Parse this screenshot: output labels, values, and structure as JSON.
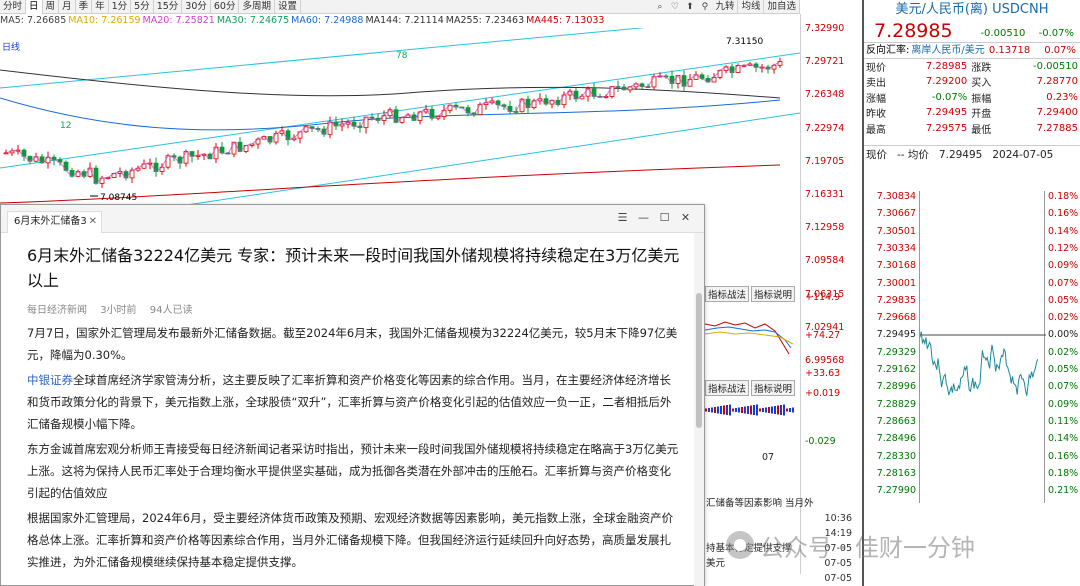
{
  "toolbar": {
    "periods": [
      "分时",
      "日",
      "周",
      "月",
      "季",
      "年",
      "1分",
      "5分",
      "15分",
      "30分",
      "60分",
      "多周期",
      "设置"
    ],
    "active_period": "日",
    "right_buttons": [
      "九转",
      "均线",
      "加自选"
    ]
  },
  "ma": [
    {
      "label": "MA5: 7.26685",
      "color": "#444"
    },
    {
      "label": "MA10: 7.26159",
      "color": "#e0a800"
    },
    {
      "label": "MA20: 7.25821",
      "color": "#d040d0"
    },
    {
      "label": "MA30: 7.24675",
      "color": "#16a05d"
    },
    {
      "label": "MA60: 7.24988",
      "color": "#1a6ad6"
    },
    {
      "label": "MA144: 7.21114",
      "color": "#333"
    },
    {
      "label": "MA255: 7.23463",
      "color": "#333"
    },
    {
      "label": "MA445: 7.13033",
      "color": "#c00"
    }
  ],
  "chart": {
    "day_label": "日线",
    "high_label": "7.31150",
    "low_label": "7.08745",
    "mark_78": "78",
    "mark_12": "12",
    "yaxis": [
      "7.32990",
      "7.29721",
      "7.26348",
      "7.22974",
      "7.19705",
      "7.16331",
      "7.12958",
      "7.09584",
      "7.06315",
      "7.02941",
      "6.99568"
    ]
  },
  "sub": {
    "tabs": [
      "指标战法",
      "指标说明"
    ],
    "yaxis_1": [
      "+114.9",
      "+74.27",
      "+33.63"
    ],
    "yaxis_2": [
      "+0.019",
      "-0.029"
    ],
    "date_label": "07"
  },
  "right": {
    "title": "美元/人民币(离) USDCNH",
    "price": "7.28985",
    "change": "-0.00510",
    "change_pct": "-0.07%",
    "rate_label": "反向汇率:",
    "rate_select": "离岸人民币/美元",
    "rate_value": "0.13718",
    "rate_pct": "0.07%",
    "quotes": [
      {
        "l1": "现价",
        "v1": "7.28985",
        "l2": "涨跌",
        "v2": "-0.00510",
        "g1": false,
        "g2": true
      },
      {
        "l1": "卖出",
        "v1": "7.29200",
        "l2": "买入",
        "v2": "7.28770",
        "g1": false,
        "g2": false
      },
      {
        "l1": "涨幅",
        "v1": "-0.07%",
        "l2": "振幅",
        "v2": "0.23%",
        "g1": true,
        "g2": false
      },
      {
        "l1": "昨收",
        "v1": "7.29495",
        "l2": "开盘",
        "v2": "7.29400",
        "g1": false,
        "g2": false
      },
      {
        "l1": "最高",
        "v1": "7.29575",
        "l2": "最低",
        "v2": "7.27885",
        "g1": false,
        "g2": false
      }
    ],
    "current_row": {
      "label": "现价",
      "dash": "-- 均价",
      "avg": "7.29495",
      "date": "2024-07-05"
    },
    "mini_left": [
      "7.30834",
      "7.30667",
      "7.30501",
      "7.30334",
      "7.30168",
      "7.30001",
      "7.29835",
      "7.29668",
      "7.29495",
      "7.29329",
      "7.29162",
      "7.28996",
      "7.28829",
      "7.28663",
      "7.28496",
      "7.28330",
      "7.28163",
      "7.27990"
    ],
    "mini_right": [
      "0.18%",
      "0.16%",
      "0.14%",
      "0.12%",
      "0.09%",
      "0.07%",
      "0.05%",
      "0.02%",
      "0.00%",
      "0.02%",
      "0.05%",
      "0.07%",
      "0.09%",
      "0.11%",
      "0.14%",
      "0.16%",
      "0.18%",
      "0.21%"
    ]
  },
  "news": {
    "tab_label": "6月末外汇储备3",
    "title": "6月末外汇储备32224亿美元 专家：预计未来一段时间我国外储规模将持续稳定在3万亿美元以上",
    "source": "每日经济新闻",
    "time": "3小时前",
    "reads": "94人已读",
    "p1": "7月7日，国家外汇管理局发布最新外汇储备数据。截至2024年6月末，我国外汇储备规模为32224亿美元，较5月末下降97亿美元，降幅为0.30%。",
    "p2_link": "中银证券",
    "p2": "全球首席经济学家管涛分析，这主要反映了汇率折算和资产价格变化等因素的综合作用。当月，在主要经济体经济增长和货币政策分化的背景下，美元指数上涨，全球股债“双升”，汇率折算与资产价格变化引起的估值效应一负一正，二者相抵后外汇储备规模小幅下降。",
    "p3": "东方金诚首席宏观分析师王青接受每日经济新闻记者采访时指出，预计未来一段时间我国外储规模将持续稳定在略高于3万亿美元上涨。这将为保持人民币汇率处于合理均衡水平提供坚实基础，成为抵御各类潜在外部冲击的压舱石。汇率折算与资产价格变化引起的估值效应",
    "p4": "根据国家外汇管理局，2024年6月，受主要经济体货币政策及预期、宏观经济数据等因素影响，美元指数上涨，全球金融资产价格总体上涨。汇率折算和资产价格等因素综合作用，当月外汇储备规模下降。但我国经济运行延续回升向好态势，高质量发展扎实推进，为外汇储备规模继续保持基本稳定提供支撑。"
  },
  "news_list": [
    {
      "title": "汇储备等因素影响 当月外",
      "time": ""
    },
    {
      "title": "",
      "time": "10:36"
    },
    {
      "title": "",
      "time": "14:19"
    },
    {
      "title": "持基本稳定提供支撑",
      "time": "07-05"
    },
    {
      "title": "美元",
      "time": "07-05"
    },
    {
      "title": "",
      "time": "07-05"
    }
  ],
  "watermark": "公众号 · 佳财一分钟"
}
